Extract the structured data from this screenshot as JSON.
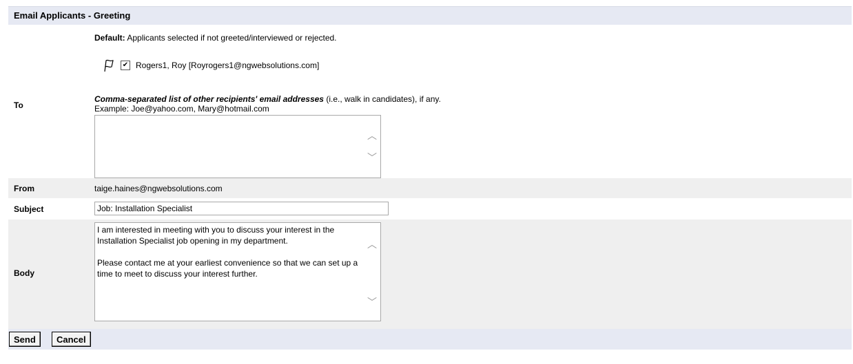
{
  "header": {
    "title": "Email Applicants - Greeting"
  },
  "to": {
    "label": "To",
    "default_bold": "Default:",
    "default_text": " Applicants selected if not greeted/interviewed or rejected.",
    "applicant": {
      "checked": true,
      "text": "Rogers1, Roy [Royrogers1@ngwebsolutions.com]"
    },
    "instruction_bold": "Comma-separated list of other recipients' email addresses",
    "instruction_text": " (i.e., walk in candidates), if any.",
    "example": "Example: Joe@yahoo.com, Mary@hotmail.com",
    "other_recipients_value": ""
  },
  "from": {
    "label": "From",
    "value": "taige.haines@ngwebsolutions.com"
  },
  "subject": {
    "label": "Subject",
    "value": "Job: Installation Specialist"
  },
  "body": {
    "label": "Body",
    "value": "I am interested in meeting with you to discuss your interest in the Installation Specialist job opening in my department.\n\nPlease contact me at your earliest convenience so that we can set up a time to meet to discuss your interest further."
  },
  "actions": {
    "send": "Send",
    "cancel": "Cancel"
  },
  "icons": {
    "flag": "flag-icon",
    "scroll_up": "chevron-up-icon",
    "scroll_down": "chevron-down-icon"
  }
}
